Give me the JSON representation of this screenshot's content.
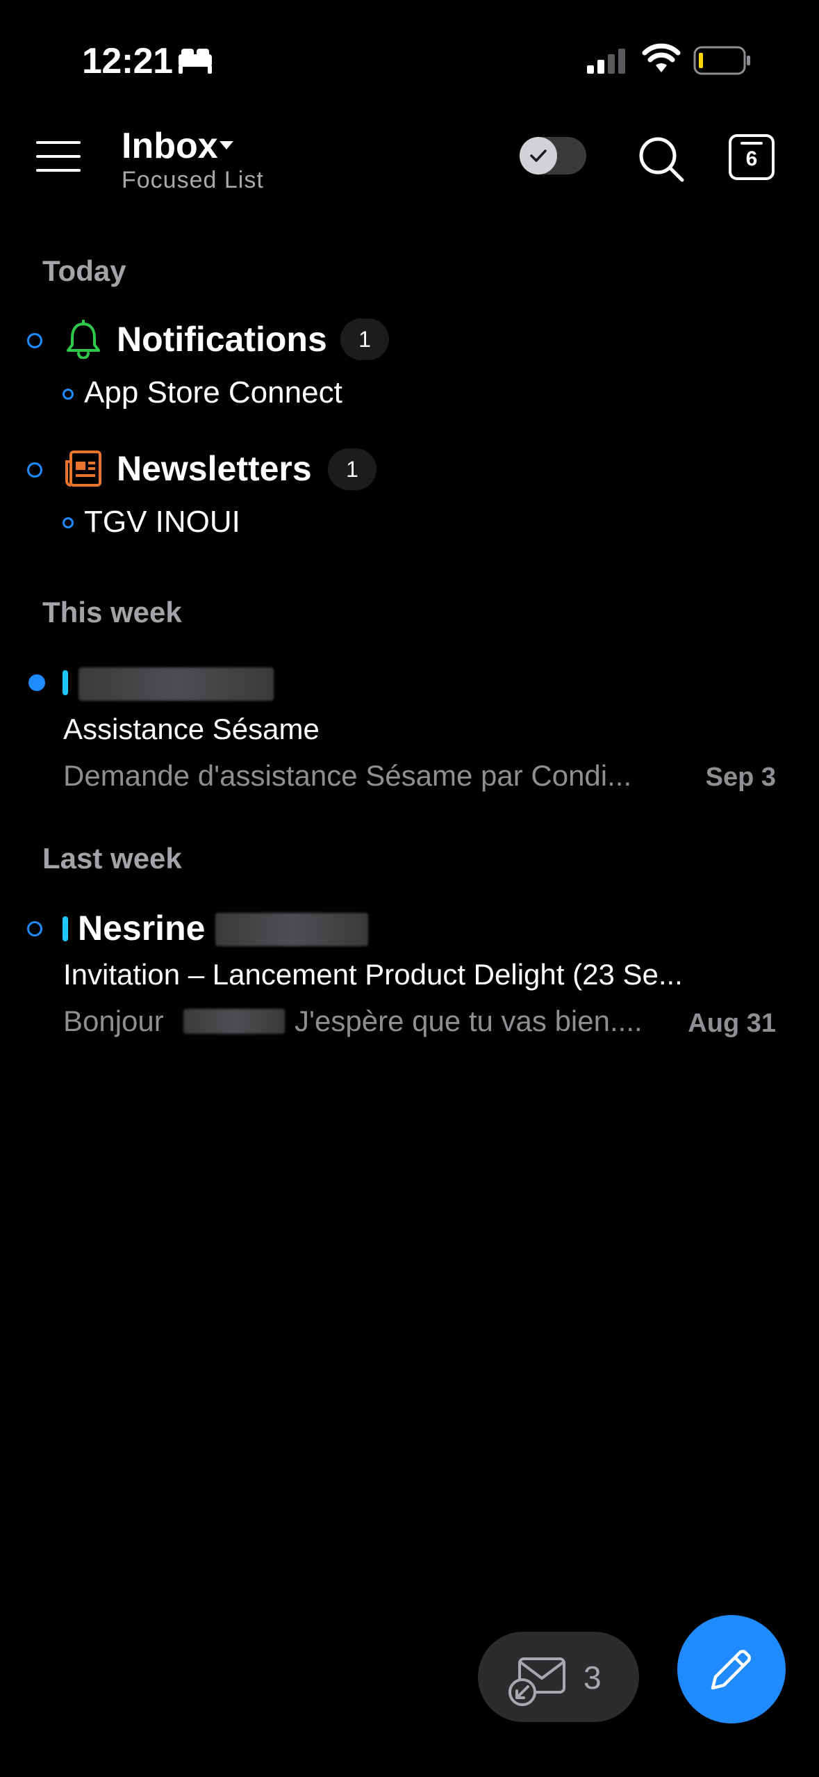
{
  "status_bar": {
    "time": "12:21"
  },
  "header": {
    "title": "Inbox",
    "subtitle": "Focused List",
    "calendar_day": "6"
  },
  "sections": {
    "today": "Today",
    "this_week": "This week",
    "last_week": "Last week"
  },
  "groups": [
    {
      "title": "Notifications",
      "count": "1",
      "item": "App Store Connect"
    },
    {
      "title": "Newsletters",
      "count": "1",
      "item": "TGV INOUI"
    }
  ],
  "messages": [
    {
      "subject": "Assistance Sésame",
      "preview": "Demande d'assistance Sésame par Condi...",
      "date": "Sep 3"
    },
    {
      "sender": "Nesrine",
      "subject": "Invitation – Lancement Product Delight (23 Se...",
      "preview_start": "Bonjour",
      "preview_end": "J'espère que tu vas bien....",
      "date": "Aug 31"
    }
  ],
  "bottom": {
    "queue_count": "3"
  },
  "colors": {
    "accent": "#1f8bff",
    "notification_green": "#2ec84a",
    "newsletter_orange": "#e8742e",
    "bar_cyan": "#1ec8ff"
  }
}
